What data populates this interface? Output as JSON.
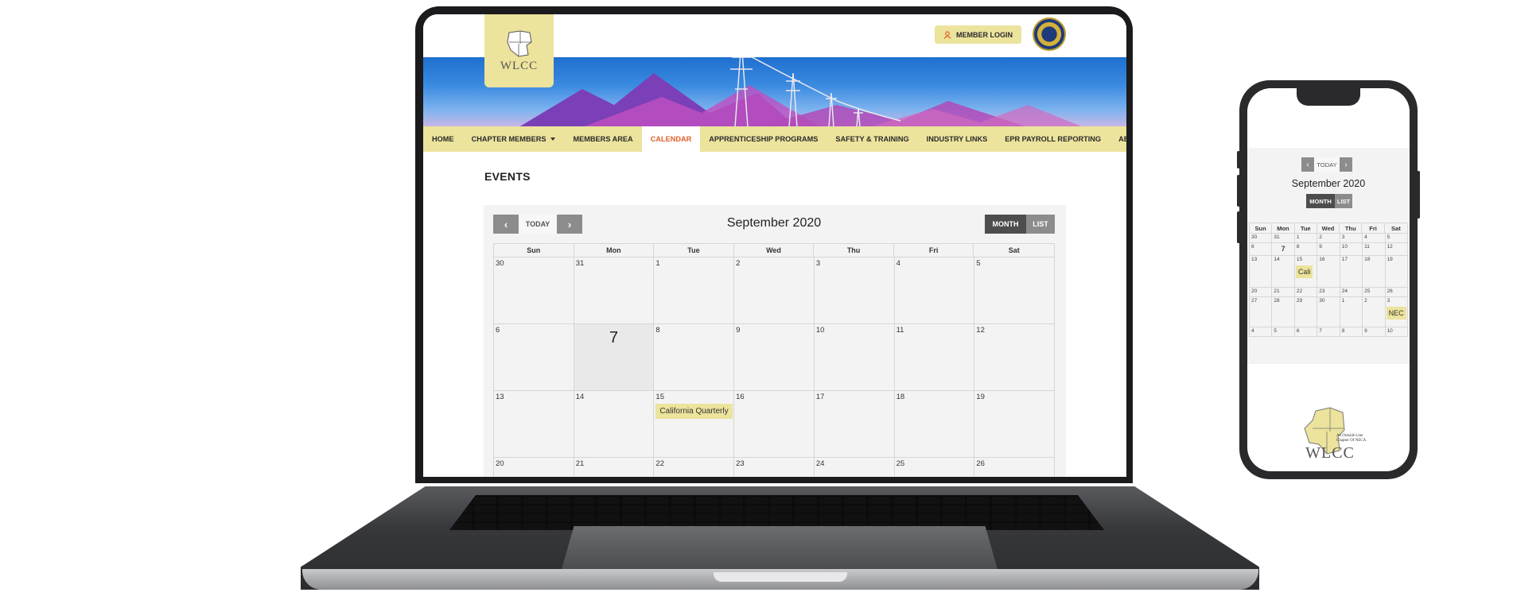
{
  "site": {
    "logo_text": "WLCC",
    "member_login": "MEMBER LOGIN",
    "nav": [
      {
        "label": "HOME"
      },
      {
        "label": "CHAPTER MEMBERS"
      },
      {
        "label": "MEMBERS AREA"
      },
      {
        "label": "CALENDAR"
      },
      {
        "label": "APPRENTICESHIP PROGRAMS"
      },
      {
        "label": "SAFETY & TRAINING"
      },
      {
        "label": "INDUSTRY LINKS"
      },
      {
        "label": "EPR PAYROLL REPORTING"
      },
      {
        "label": "ABOUT US"
      }
    ],
    "active_nav": "CALENDAR",
    "accent_color": "#ece39c",
    "active_color": "#e0602a"
  },
  "events": {
    "heading": "EVENTS"
  },
  "calendar": {
    "today_label": "TODAY",
    "prev_icon": "‹",
    "next_icon": "›",
    "title": "September 2020",
    "month_label": "MONTH",
    "list_label": "LIST",
    "days_of_week": [
      "Sun",
      "Mon",
      "Tue",
      "Wed",
      "Thu",
      "Fri",
      "Sat"
    ],
    "weeks": [
      [
        "30",
        "31",
        "1",
        "2",
        "3",
        "4",
        "5"
      ],
      [
        "6",
        "7",
        "8",
        "9",
        "10",
        "11",
        "12"
      ],
      [
        "13",
        "14",
        "15",
        "16",
        "17",
        "18",
        "19"
      ],
      [
        "20",
        "21",
        "22",
        "23",
        "24",
        "25",
        "26"
      ]
    ],
    "today_day": "7",
    "event_label": "California Quarterly"
  },
  "phone": {
    "today_label": "TODAY",
    "title": "September 2020",
    "month_label": "MONTH",
    "list_label": "LIST",
    "days_of_week": [
      "Sun",
      "Mon",
      "Tue",
      "Wed",
      "Thu",
      "Fri",
      "Sat"
    ],
    "weeks": [
      [
        "30",
        "31",
        "1",
        "2",
        "3",
        "4",
        "5"
      ],
      [
        "6",
        "7",
        "8",
        "9",
        "10",
        "11",
        "12"
      ],
      [
        "13",
        "14",
        "15",
        "16",
        "17",
        "18",
        "19"
      ],
      [
        "20",
        "21",
        "22",
        "23",
        "24",
        "25",
        "26"
      ],
      [
        "27",
        "28",
        "29",
        "30",
        "1",
        "2",
        "3"
      ],
      [
        "4",
        "5",
        "6",
        "7",
        "8",
        "9",
        "10"
      ]
    ],
    "event_cali": "Cali",
    "event_nec": "NEC",
    "footer_logo_text": "WLCC",
    "footer_small_text": "An Outside Line Chapter Of NECA"
  }
}
